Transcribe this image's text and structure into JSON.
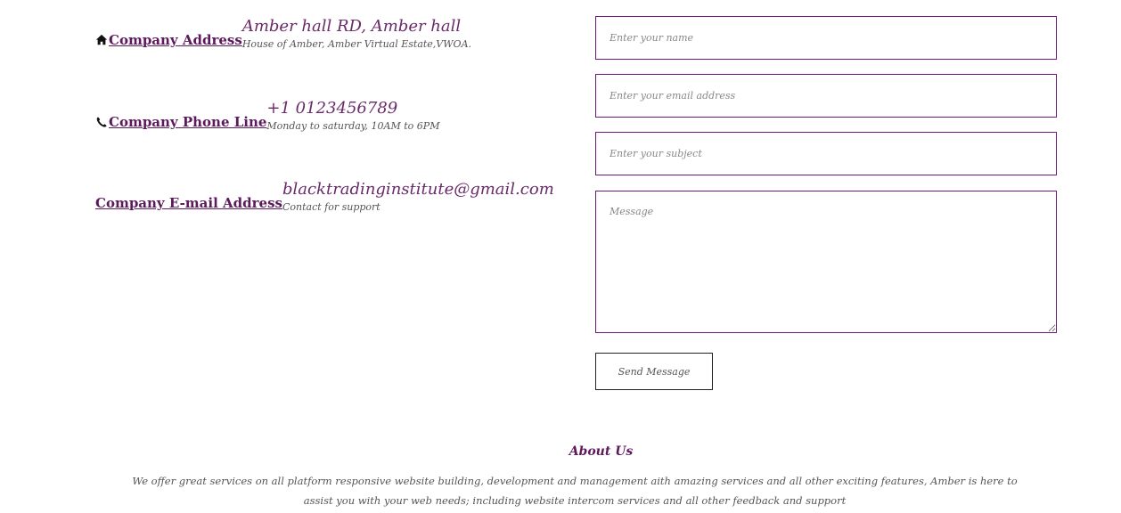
{
  "contact_info": {
    "address": {
      "label": "Company Address",
      "value": "Amber hall RD, Amber hall",
      "sub": "House of Amber, Amber Virtual Estate,VWOA.",
      "icon": "home-icon"
    },
    "phone": {
      "label": "Company Phone Line",
      "value": "+1 0123456789",
      "sub": "Monday to saturday, 10AM to 6PM",
      "icon": "phone-icon"
    },
    "email": {
      "label": "Company E-mail Address",
      "value": "blacktradinginstitute@gmail.com",
      "sub": "Contact for support"
    }
  },
  "form": {
    "name_placeholder": "Enter your name",
    "email_placeholder": "Enter your email address",
    "subject_placeholder": "Enter your subject",
    "message_placeholder": "Message",
    "send_label": "Send Message"
  },
  "about": {
    "title": "About Us",
    "text": "We offer great services on all platform responsive website building, development and management aith amazing services and all other exciting features, Amber is here to assist you with your web needs; including website intercom services and all other feedback and support"
  },
  "colors": {
    "accent": "#5c1a5c",
    "field_border": "#6a1b7a"
  }
}
